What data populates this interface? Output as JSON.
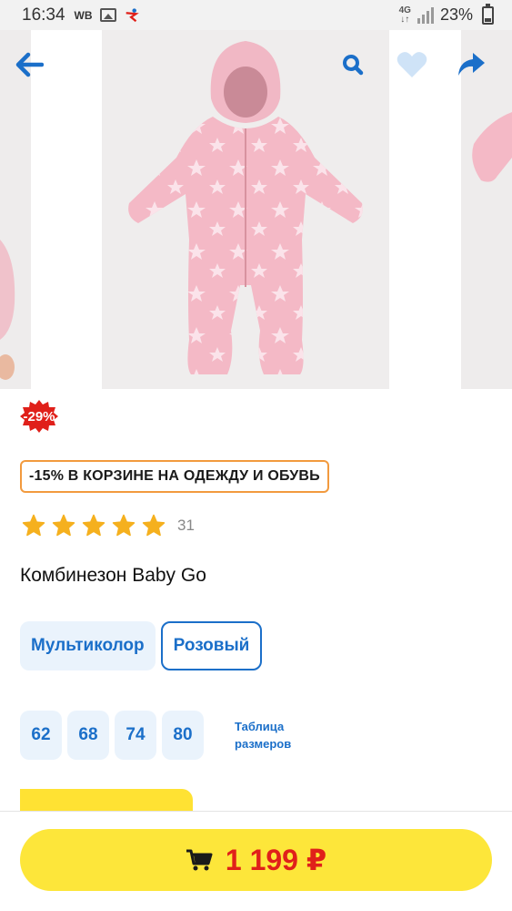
{
  "status_bar": {
    "time": "16:34",
    "carrier": "WB",
    "network": "4G",
    "battery": "23%"
  },
  "toolbar": {
    "icons": [
      "back-arrow-icon",
      "search-icon",
      "heart-icon",
      "share-icon"
    ],
    "accent_color": "#1b6fc9",
    "favorite_color": "#cfe3f7"
  },
  "product": {
    "discount_badge": "-29%",
    "discount_color": "#e0201a",
    "promo": "-15% В КОРЗИНЕ НА ОДЕЖДУ И ОБУВЬ",
    "rating_stars": 5,
    "reviews_count": "31",
    "title": "Комбинезон Baby Go",
    "colors": [
      {
        "label": "Мультиколор",
        "selected": false
      },
      {
        "label": "Розовый",
        "selected": true
      }
    ],
    "sizes": [
      "62",
      "68",
      "74",
      "80"
    ],
    "size_table_label": "Таблица размеров"
  },
  "buy_bar": {
    "price": "1 199 ₽",
    "button_color": "#fde63a",
    "cart_icon": "cart-icon"
  }
}
